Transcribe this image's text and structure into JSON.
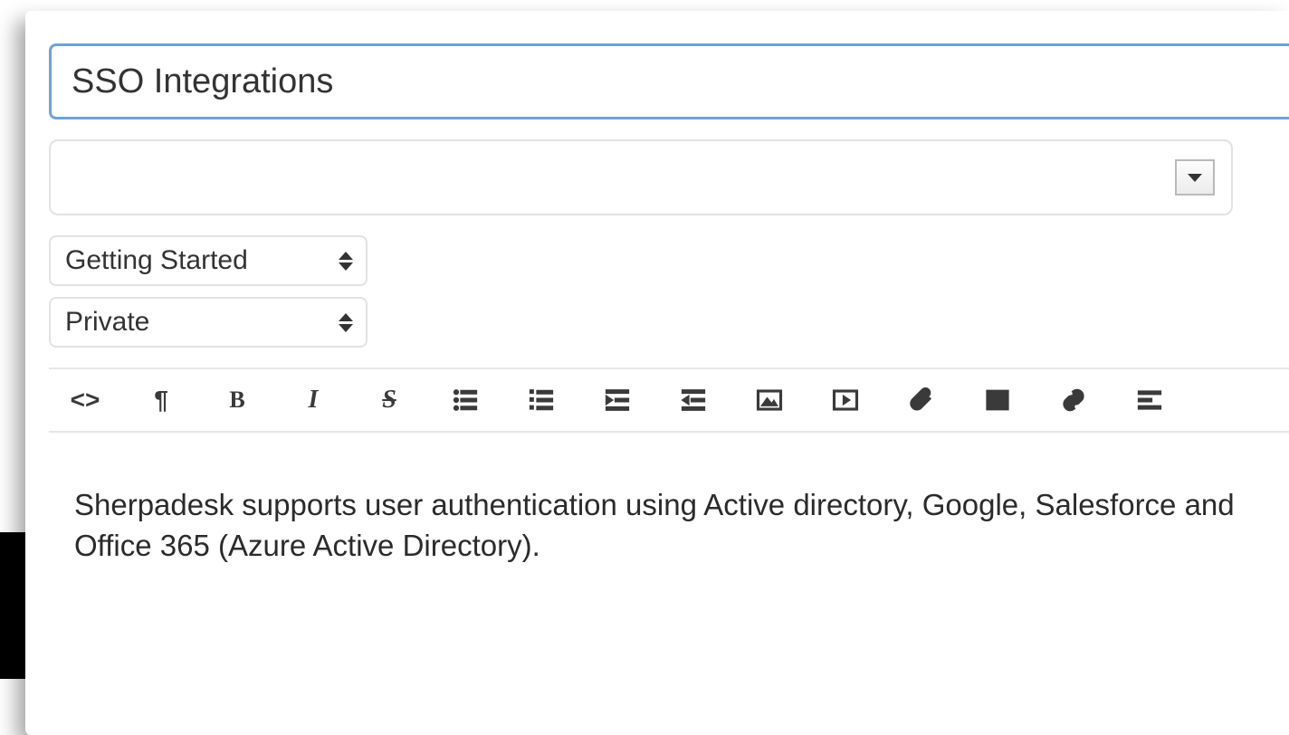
{
  "title_field": {
    "value": "SSO Integrations"
  },
  "tag_combo": {
    "value": ""
  },
  "category_select": {
    "value": "Getting Started"
  },
  "visibility_select": {
    "value": "Private"
  },
  "toolbar": {
    "code": "<>",
    "paragraph": "¶",
    "bold": "B",
    "italic": "I",
    "strike": "S"
  },
  "editor": {
    "content": "Sherpadesk supports user authentication using Active directory, Google, Salesforce and Office 365 (Azure Active Directory)."
  }
}
